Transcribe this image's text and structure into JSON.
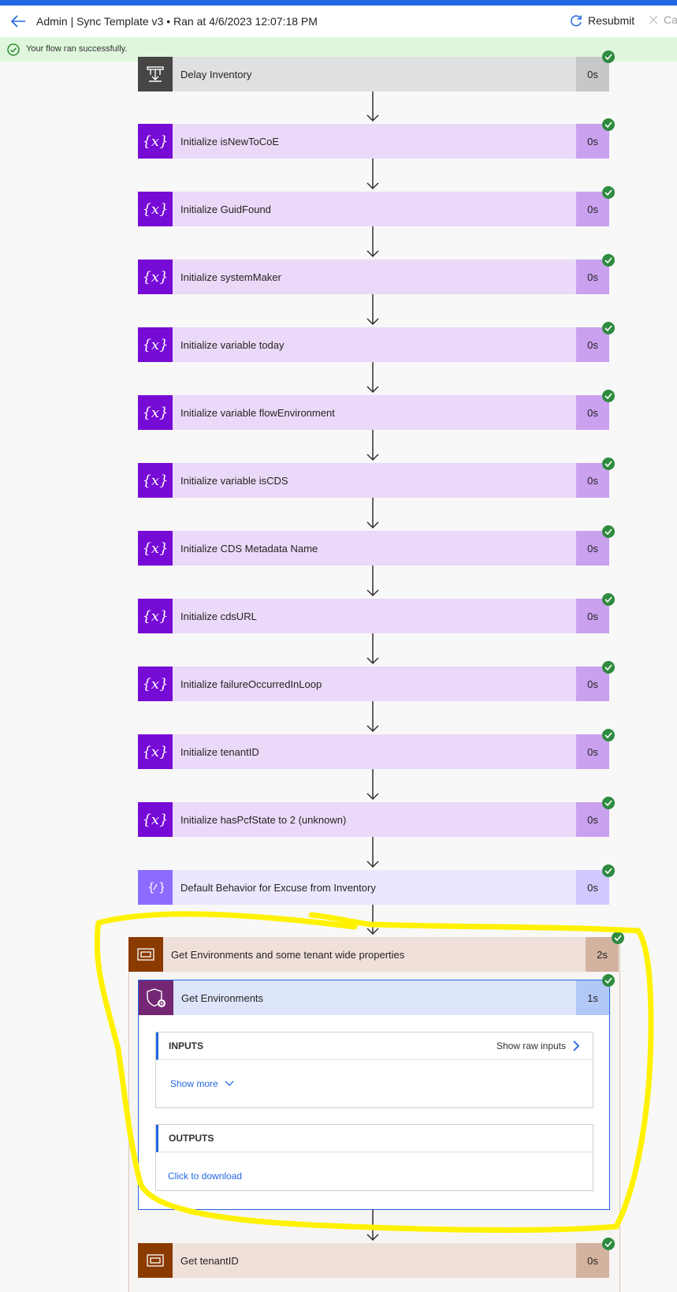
{
  "header": {
    "title": "Admin | Sync Template v3 • Ran at 4/6/2023 12:07:18 PM",
    "resubmit_label": "Resubmit",
    "cancel_label": "Ca"
  },
  "banner": {
    "text": "Your flow ran successfully."
  },
  "steps": [
    {
      "label": "Delay Inventory",
      "duration": "0s",
      "icon": "delay-icon"
    },
    {
      "label": "Initialize isNewToCoE",
      "duration": "0s",
      "icon": "variable-icon"
    },
    {
      "label": "Initialize GuidFound",
      "duration": "0s",
      "icon": "variable-icon"
    },
    {
      "label": "Initialize systemMaker",
      "duration": "0s",
      "icon": "variable-icon"
    },
    {
      "label": "Initialize variable today",
      "duration": "0s",
      "icon": "variable-icon"
    },
    {
      "label": "Initialize variable flowEnvironment",
      "duration": "0s",
      "icon": "variable-icon"
    },
    {
      "label": "Initialize variable isCDS",
      "duration": "0s",
      "icon": "variable-icon"
    },
    {
      "label": "Initialize CDS Metadata Name",
      "duration": "0s",
      "icon": "variable-icon"
    },
    {
      "label": "Initialize cdsURL",
      "duration": "0s",
      "icon": "variable-icon"
    },
    {
      "label": "Initialize failureOccurredInLoop",
      "duration": "0s",
      "icon": "variable-icon"
    },
    {
      "label": "Initialize tenantID",
      "duration": "0s",
      "icon": "variable-icon"
    },
    {
      "label": "Initialize hasPcfState to 2 (unknown)",
      "duration": "0s",
      "icon": "variable-icon"
    },
    {
      "label": "Default Behavior for Excuse from Inventory",
      "duration": "0s",
      "icon": "compose-icon"
    }
  ],
  "scope": {
    "label": "Get Environments and some tenant wide properties",
    "duration": "2s",
    "action": {
      "label": "Get Environments",
      "duration": "1s",
      "inputs": {
        "title": "INPUTS",
        "raw_label": "Show raw inputs",
        "show_more": "Show more"
      },
      "outputs": {
        "title": "OUTPUTS",
        "download_label": "Click to download"
      }
    }
  },
  "last_step": {
    "label": "Get tenantID",
    "duration": "0s"
  },
  "colors": {
    "variable_icon": "#770bd6",
    "scope_icon": "#8b3a00",
    "success": "#2e8b3f",
    "highlight": "#fff200",
    "accent": "#2266e3"
  }
}
